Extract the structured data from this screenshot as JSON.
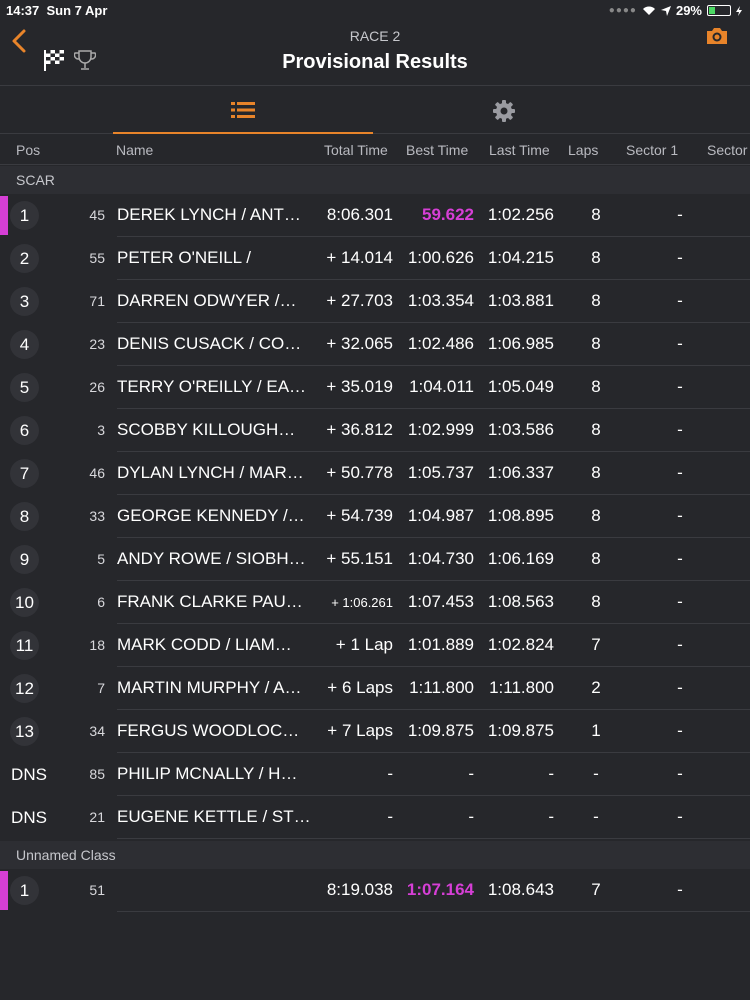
{
  "status": {
    "time": "14:37",
    "date": "Sun 7 Apr",
    "battery": "29%",
    "battery_fraction": 0.29
  },
  "nav": {
    "race": "RACE 2",
    "title": "Provisional Results",
    "icons": [
      "back-chevron",
      "checkered-flag",
      "trophy",
      "camera"
    ]
  },
  "tabs": [
    {
      "icon": "list",
      "active": true
    },
    {
      "icon": "gear",
      "active": false
    }
  ],
  "columns": {
    "pos": "Pos",
    "name": "Name",
    "total": "Total Time",
    "best": "Best Time",
    "last": "Last Time",
    "laps": "Laps",
    "sector1": "Sector 1",
    "sector2": "Sector"
  },
  "colors": {
    "accent": "#e8842a",
    "fastest": "#d63fd6",
    "background": "#26272b"
  },
  "classes": [
    {
      "name": "SCAR",
      "rows": [
        {
          "pos": "1",
          "num": "45",
          "name": "DEREK LYNCH / ANT…",
          "total": "8:06.301",
          "best": "59.622",
          "last": "1:02.256",
          "laps": "8",
          "s1": "-",
          "fastest": true
        },
        {
          "pos": "2",
          "num": "55",
          "name": "PETER O'NEILL /",
          "total": "+ 14.014",
          "best": "1:00.626",
          "last": "1:04.215",
          "laps": "8",
          "s1": "-"
        },
        {
          "pos": "3",
          "num": "71",
          "name": "DARREN ODWYER /…",
          "total": "+ 27.703",
          "best": "1:03.354",
          "last": "1:03.881",
          "laps": "8",
          "s1": "-"
        },
        {
          "pos": "4",
          "num": "23",
          "name": "DENIS CUSACK / CO…",
          "total": "+ 32.065",
          "best": "1:02.486",
          "last": "1:06.985",
          "laps": "8",
          "s1": "-"
        },
        {
          "pos": "5",
          "num": "26",
          "name": "TERRY O'REILLY / EA…",
          "total": "+ 35.019",
          "best": "1:04.011",
          "last": "1:05.049",
          "laps": "8",
          "s1": "-"
        },
        {
          "pos": "6",
          "num": "3",
          "name": "SCOBBY  KILLOUGH…",
          "total": "+ 36.812",
          "best": "1:02.999",
          "last": "1:03.586",
          "laps": "8",
          "s1": "-"
        },
        {
          "pos": "7",
          "num": "46",
          "name": "DYLAN LYNCH / MAR…",
          "total": "+ 50.778",
          "best": "1:05.737",
          "last": "1:06.337",
          "laps": "8",
          "s1": "-"
        },
        {
          "pos": "8",
          "num": "33",
          "name": "GEORGE KENNEDY /…",
          "total": "+ 54.739",
          "best": "1:04.987",
          "last": "1:08.895",
          "laps": "8",
          "s1": "-"
        },
        {
          "pos": "9",
          "num": "5",
          "name": "ANDY ROWE / SIOBH…",
          "total": "+ 55.151",
          "best": "1:04.730",
          "last": "1:06.169",
          "laps": "8",
          "s1": "-"
        },
        {
          "pos": "10",
          "num": "6",
          "name": "FRANK CLARKE PAU…",
          "total": "+ 1:06.261",
          "best": "1:07.453",
          "last": "1:08.563",
          "laps": "8",
          "s1": "-",
          "small_total": true
        },
        {
          "pos": "11",
          "num": "18",
          "name": "MARK CODD / LIAM…",
          "total": "+ 1 Lap",
          "best": "1:01.889",
          "last": "1:02.824",
          "laps": "7",
          "s1": "-"
        },
        {
          "pos": "12",
          "num": "7",
          "name": "MARTIN MURPHY / A…",
          "total": "+ 6 Laps",
          "best": "1:11.800",
          "last": "1:11.800",
          "laps": "2",
          "s1": "-"
        },
        {
          "pos": "13",
          "num": "34",
          "name": "FERGUS WOODLOC…",
          "total": "+ 7 Laps",
          "best": "1:09.875",
          "last": "1:09.875",
          "laps": "1",
          "s1": "-"
        },
        {
          "pos": "DNS",
          "num": "85",
          "name": "PHILIP MCNALLY / H…",
          "total": "-",
          "best": "-",
          "last": "-",
          "laps": "-",
          "s1": "-",
          "dns": true
        },
        {
          "pos": "DNS",
          "num": "21",
          "name": "EUGENE KETTLE / ST…",
          "total": "-",
          "best": "-",
          "last": "-",
          "laps": "-",
          "s1": "-",
          "dns": true
        }
      ]
    },
    {
      "name": "Unnamed Class",
      "rows": [
        {
          "pos": "1",
          "num": "51",
          "name": "",
          "total": "8:19.038",
          "best": "1:07.164",
          "last": "1:08.643",
          "laps": "7",
          "s1": "-",
          "fastest": true
        }
      ]
    }
  ]
}
